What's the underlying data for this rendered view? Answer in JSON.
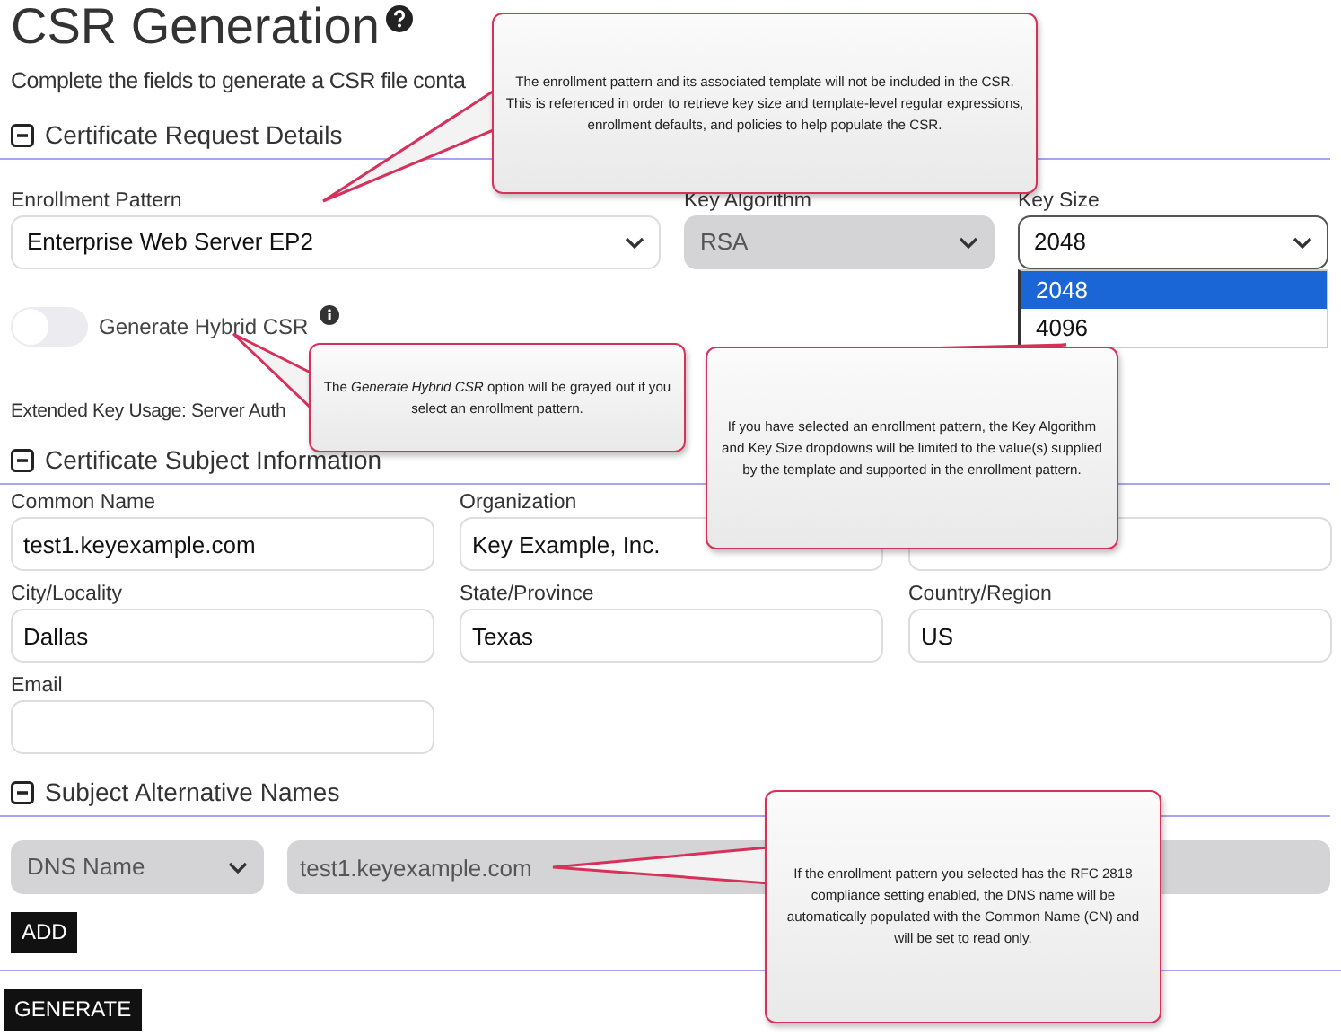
{
  "title": "CSR Generation",
  "subtitle": "Complete the fields to generate a CSR file conta",
  "request_details": {
    "heading": "Certificate Request Details",
    "expanded": true,
    "fields": [
      {
        "label": "Enrollment Pattern",
        "value": "Enterprise Web Server EP2",
        "disabled": false
      },
      {
        "label": "Key Algorithm",
        "value": "RSA",
        "disabled": true
      },
      {
        "label": "Key Size",
        "value": "2048",
        "disabled": false,
        "expanded": true,
        "options": [
          {
            "label": "2048",
            "selected": true
          },
          {
            "label": "4096",
            "selected": false
          }
        ]
      }
    ],
    "hybrid_toggle": {
      "label": "Generate Hybrid CSR",
      "on": false
    },
    "extended_key_usage": "Extended Key Usage: Server Auth"
  },
  "subject_info": {
    "heading": "Certificate Subject Information",
    "expanded": true,
    "fields": [
      {
        "label": "Common Name",
        "value": "test1.keyexample.com",
        "disabled": false
      },
      {
        "label": "Organization",
        "value": "Key Example, Inc.",
        "disabled": false
      },
      {
        "disabled": false
      },
      {
        "label": "City/Locality",
        "value": "Dallas",
        "disabled": false
      },
      {
        "label": "State/Province",
        "value": "Texas",
        "disabled": false
      },
      {
        "label": "Country/Region",
        "value": "US",
        "disabled": false
      },
      {
        "label": "Email",
        "disabled": false
      }
    ]
  },
  "san": {
    "heading": "Subject Alternative Names",
    "expanded": true,
    "type": "DNS Name",
    "value": "test1.keyexample.com",
    "disabled": true,
    "add_button": "ADD"
  },
  "generate_button": "GENERATE",
  "callouts": [
    {
      "text": "The enrollment pattern and its associated template will not be included in the CSR. This is referenced in order to retrieve key size and template-level regular expressions, enrollment defaults, and policies  to help populate the CSR."
    },
    {
      "text": "The *Generate Hybrid CSR* option will be grayed out if you select an enrollment pattern."
    },
    {
      "text": "If you have selected an enrollment pattern, the Key Algorithm and Key Size dropdowns will be limited to the value(s) supplied by the template and supported in the enrollment pattern."
    },
    {
      "text": "If the enrollment pattern you selected has the RFC 2818 compliance setting enabled, the DNS name will be automatically populated with the Common Name (CN) and will be set to read only."
    }
  ]
}
